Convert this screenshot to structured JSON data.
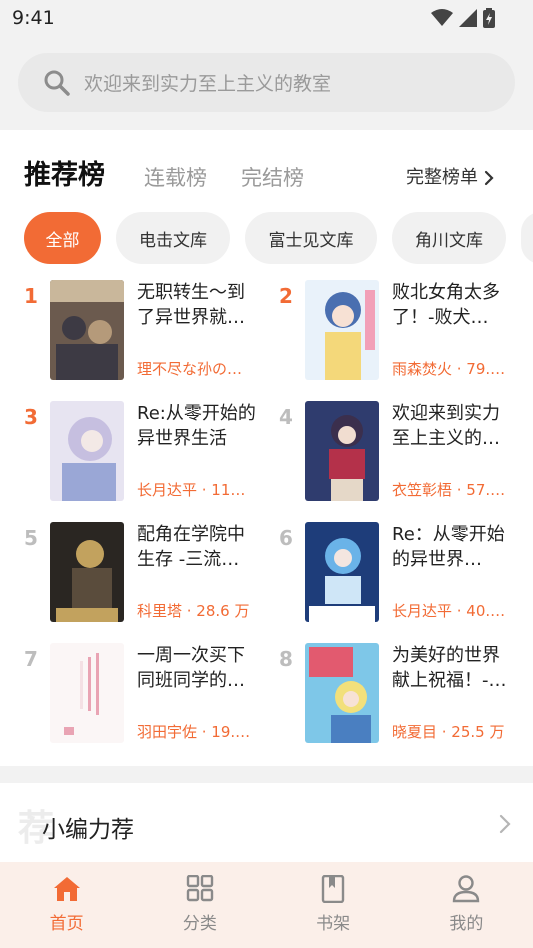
{
  "status_bar": {
    "time": "9:41"
  },
  "search": {
    "placeholder": "欢迎来到实力至上主义的教室"
  },
  "ranking": {
    "tabs": [
      {
        "label": "推荐榜",
        "active": true
      },
      {
        "label": "连载榜",
        "active": false
      },
      {
        "label": "完结榜",
        "active": false
      }
    ],
    "full_list_label": "完整榜单",
    "filters": [
      {
        "label": "全部",
        "active": true
      },
      {
        "label": "电击文库",
        "active": false
      },
      {
        "label": "富士见文库",
        "active": false
      },
      {
        "label": "角川文库",
        "active": false
      }
    ],
    "books": [
      {
        "rank": "1",
        "title": "无职转生～到了异世界就…",
        "meta": "理不尽な孙の…",
        "cover_colors": [
          "#6b5a4e",
          "#c9b79b",
          "#3d3a44"
        ]
      },
      {
        "rank": "2",
        "title": "败北女角太多了！-败犬…",
        "meta": "雨森焚火 · 79.…",
        "cover_colors": [
          "#e9f2fa",
          "#4a6fb0",
          "#f4d87a"
        ]
      },
      {
        "rank": "3",
        "title": "Re:从零开始的异世界生活",
        "meta": "长月达平 · 11…",
        "cover_colors": [
          "#e7e4f1",
          "#9aa7d6",
          "#c6bfe0"
        ]
      },
      {
        "rank": "4",
        "title": "欢迎来到实力至上主义的…",
        "meta": "衣笠彰梧 · 57.…",
        "cover_colors": [
          "#2f3c6e",
          "#b4314a",
          "#e5d8c8"
        ]
      },
      {
        "rank": "5",
        "title": "配角在学院中生存 -三流…",
        "meta": "科里塔 · 28.6 万",
        "cover_colors": [
          "#2a2622",
          "#c2a25e",
          "#5a4c3c"
        ]
      },
      {
        "rank": "6",
        "title": "Re：从零开始的异世界…",
        "meta": "长月达平 · 40.…",
        "cover_colors": [
          "#1e3d7a",
          "#6ab3e8",
          "#cfe6f7"
        ]
      },
      {
        "rank": "7",
        "title": "一周一次买下同班同学的…",
        "meta": "羽田宇佐 · 19.…",
        "cover_colors": [
          "#fbf6f6",
          "#e9a4b4",
          "#f4e0e4"
        ]
      },
      {
        "rank": "8",
        "title": "为美好的世界献上祝福！-…",
        "meta": "晓夏目 · 25.5 万",
        "cover_colors": [
          "#7ec7e8",
          "#e25a6f",
          "#f2e07b"
        ]
      }
    ]
  },
  "editor_picks": {
    "title": "小编力荐",
    "watermark": "荐"
  },
  "bottom_nav": [
    {
      "label": "首页",
      "icon": "home-icon",
      "active": true
    },
    {
      "label": "分类",
      "icon": "grid-icon",
      "active": false
    },
    {
      "label": "书架",
      "icon": "bookmark-icon",
      "active": false
    },
    {
      "label": "我的",
      "icon": "user-icon",
      "active": false
    }
  ],
  "colors": {
    "accent": "#f26b35",
    "nav_bg": "#fbefe9",
    "page_bg": "#f2f2f2"
  }
}
